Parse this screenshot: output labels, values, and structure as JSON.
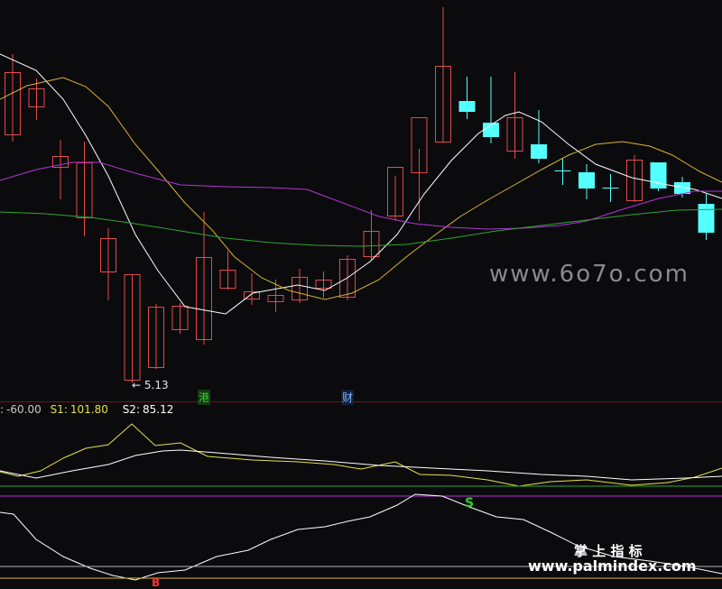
{
  "candles": [
    {
      "o": 150,
      "c": 80,
      "h": 60,
      "l": 157
    },
    {
      "o": 119,
      "c": 98,
      "h": 87,
      "l": 133
    },
    {
      "o": 186,
      "c": 173,
      "h": 155,
      "l": 221
    },
    {
      "o": 242,
      "c": 180,
      "h": 157,
      "l": 262
    },
    {
      "o": 302,
      "c": 264,
      "h": 253,
      "l": 333
    },
    {
      "o": 422,
      "c": 304,
      "h": 304,
      "l": 424
    },
    {
      "o": 408,
      "c": 340,
      "h": 337,
      "l": 409
    },
    {
      "o": 366,
      "c": 339,
      "h": 336,
      "l": 370
    },
    {
      "o": 377,
      "c": 285,
      "h": 235,
      "l": 382
    },
    {
      "o": 320,
      "c": 299,
      "h": 278,
      "l": 321
    },
    {
      "o": 332,
      "c": 323,
      "h": 303,
      "l": 338
    },
    {
      "o": 335,
      "c": 327,
      "h": 310,
      "l": 346
    },
    {
      "o": 333,
      "c": 307,
      "h": 298,
      "l": 336
    },
    {
      "o": 320,
      "c": 310,
      "h": 301,
      "l": 330
    },
    {
      "o": 330,
      "c": 287,
      "h": 283,
      "l": 333
    },
    {
      "o": 285,
      "c": 256,
      "h": 233,
      "l": 288
    },
    {
      "o": 240,
      "c": 185,
      "h": 195,
      "l": 245
    },
    {
      "o": 192,
      "c": 130,
      "h": 165,
      "l": 245
    },
    {
      "o": 158,
      "c": 73,
      "h": 8,
      "l": 158
    },
    {
      "o": 112,
      "c": 124,
      "h": 85,
      "l": 132
    },
    {
      "o": 136,
      "c": 152,
      "h": 85,
      "l": 159
    },
    {
      "o": 168,
      "c": 130,
      "h": 80,
      "l": 176
    },
    {
      "o": 160,
      "c": 176,
      "h": 122,
      "l": 181
    },
    {
      "o": 189,
      "c": 190,
      "h": 175,
      "l": 205
    },
    {
      "o": 191,
      "c": 209,
      "h": 182,
      "l": 221
    },
    {
      "o": 208,
      "c": 209,
      "h": 193,
      "l": 224
    },
    {
      "o": 223,
      "c": 177,
      "h": 172,
      "l": 224
    },
    {
      "o": 180,
      "c": 209,
      "h": 180,
      "l": 212
    },
    {
      "o": 202,
      "c": 215,
      "h": 196,
      "l": 219
    },
    {
      "o": 226,
      "c": 258,
      "h": 215,
      "l": 266
    }
  ],
  "annotations": {
    "low_price": "5.13",
    "mark_1": "港",
    "mark_2": "财"
  },
  "indicator": {
    "label_prefix": ":",
    "v0": "-60.00",
    "s1_label": "S1:",
    "s1_value": "101.80",
    "s2_label": "S2:",
    "s2_value": "85.12",
    "signal_s": "S",
    "signal_b": "B"
  },
  "watermarks": {
    "site_main": "www.6o7o.com",
    "brand_cn": "掌 上 指 标",
    "site_bottom": "www.palmindex.com"
  },
  "colors": {
    "up": "#e24b4b",
    "down": "#54ffff",
    "ma_white": "#ffffff",
    "ma_yellow": "#d9b230",
    "ma_purple": "#b334d9",
    "ma_green": "#2fa52f",
    "line_yellow": "#e6e14a",
    "bg": "#0b0b0d"
  }
}
